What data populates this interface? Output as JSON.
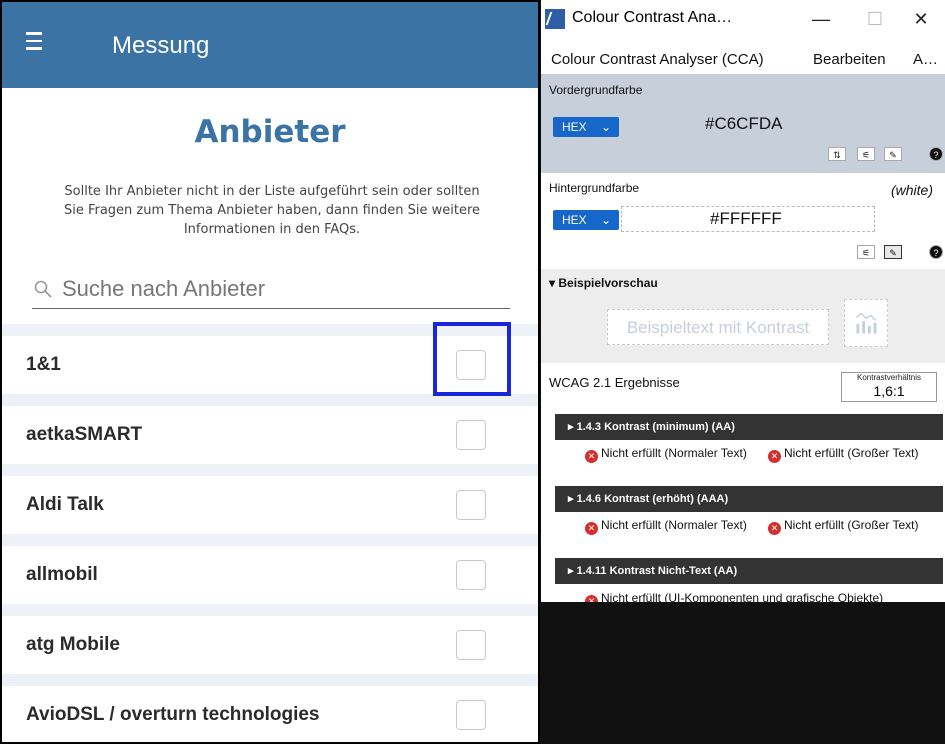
{
  "app": {
    "title": "Messung",
    "heading": "Anbieter",
    "intro": "Sollte Ihr Anbieter nicht in der Liste aufgeführt sein oder sollten Sie Fragen zum Thema Anbieter haben, dann finden Sie weitere Informationen in den FAQs.",
    "search_placeholder": "Suche nach Anbieter",
    "providers": [
      {
        "name": "1&1",
        "checked": false
      },
      {
        "name": "aetkaSMART",
        "checked": false
      },
      {
        "name": "Aldi Talk",
        "checked": false
      },
      {
        "name": "allmobil",
        "checked": false
      },
      {
        "name": "atg Mobile",
        "checked": false
      },
      {
        "name": "AvioDSL / overturn technologies",
        "checked": false
      }
    ],
    "colors": {
      "accent": "#3a73a4",
      "focus": "#1a26d9"
    }
  },
  "cca": {
    "window_title": "Colour Contrast Ana…",
    "window_buttons": {
      "minimize": "—",
      "maximize": "☐",
      "close": "✕"
    },
    "menu": [
      "Colour Contrast Analyser (CCA)",
      "Bearbeiten",
      "A…"
    ],
    "foreground": {
      "label": "Vordergrundfarbe",
      "format": "HEX",
      "value": "#C6CFDA",
      "color": "#c6cfda"
    },
    "background": {
      "label": "Hintergrundfarbe",
      "note": "(white)",
      "format": "HEX",
      "value": "#FFFFFF",
      "color": "#ffffff"
    },
    "preview": {
      "label": "▾ Beispielvorschau",
      "sample_text": "Beispieltext mit Kontrast"
    },
    "wcag": {
      "label": "WCAG 2.1 Ergebnisse",
      "ratio_label": "Kontrastverhältnis",
      "ratio_value": "1,6:1",
      "criteria": [
        {
          "title": "▸ 1.4.3 Kontrast (minimum) (AA)",
          "results": [
            "Nicht erfüllt (Normaler Text)",
            "Nicht erfüllt (Großer Text)"
          ]
        },
        {
          "title": "▸ 1.4.6 Kontrast (erhöht) (AAA)",
          "results": [
            "Nicht erfüllt (Normaler Text)",
            "Nicht erfüllt (Großer Text)"
          ]
        },
        {
          "title": "▸ 1.4.11 Kontrast Nicht-Text (AA)",
          "results": [
            "Nicht erfüllt (UI-Komponenten und grafische Objekte)"
          ]
        }
      ]
    }
  }
}
